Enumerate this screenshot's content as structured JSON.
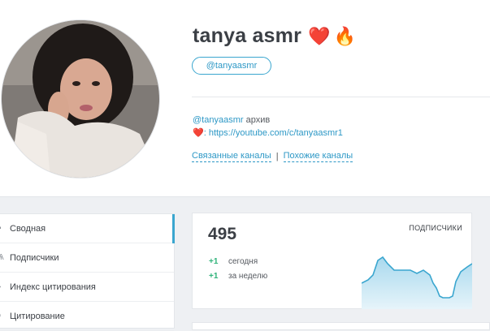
{
  "channel": {
    "name": "tanya asmr",
    "emojis": [
      "❤️",
      "🔥"
    ],
    "handle_pill": "@tanyaasmr",
    "description": {
      "handle": "@tanyaasmr",
      "suffix": " архив",
      "heart": "❤️",
      "colon": ": ",
      "url": "https://youtube.com/c/tanyaasmr1"
    },
    "related_link": "Связанные каналы",
    "separator": "|",
    "similar_link": "Похожие каналы"
  },
  "sidebar": {
    "items": [
      {
        "icon": "summary-icon",
        "label": "Сводная",
        "active": true
      },
      {
        "icon": "subscribers-icon",
        "label": "Подписчики",
        "active": false
      },
      {
        "icon": "citation-index-icon",
        "label": "Индекс цитирования",
        "active": false
      },
      {
        "icon": "citation-icon",
        "label": "Цитирование",
        "active": false
      }
    ]
  },
  "stats": {
    "subscribers": "495",
    "label": "ПОДПИСЧИКИ",
    "today_delta": "+1",
    "today_label": "сегодня",
    "week_delta": "+1",
    "week_label": "за неделю"
  },
  "colors": {
    "accent": "#3aa6cf",
    "positive": "#2fb37a",
    "sparkline_fill": "#bfe3f2"
  }
}
